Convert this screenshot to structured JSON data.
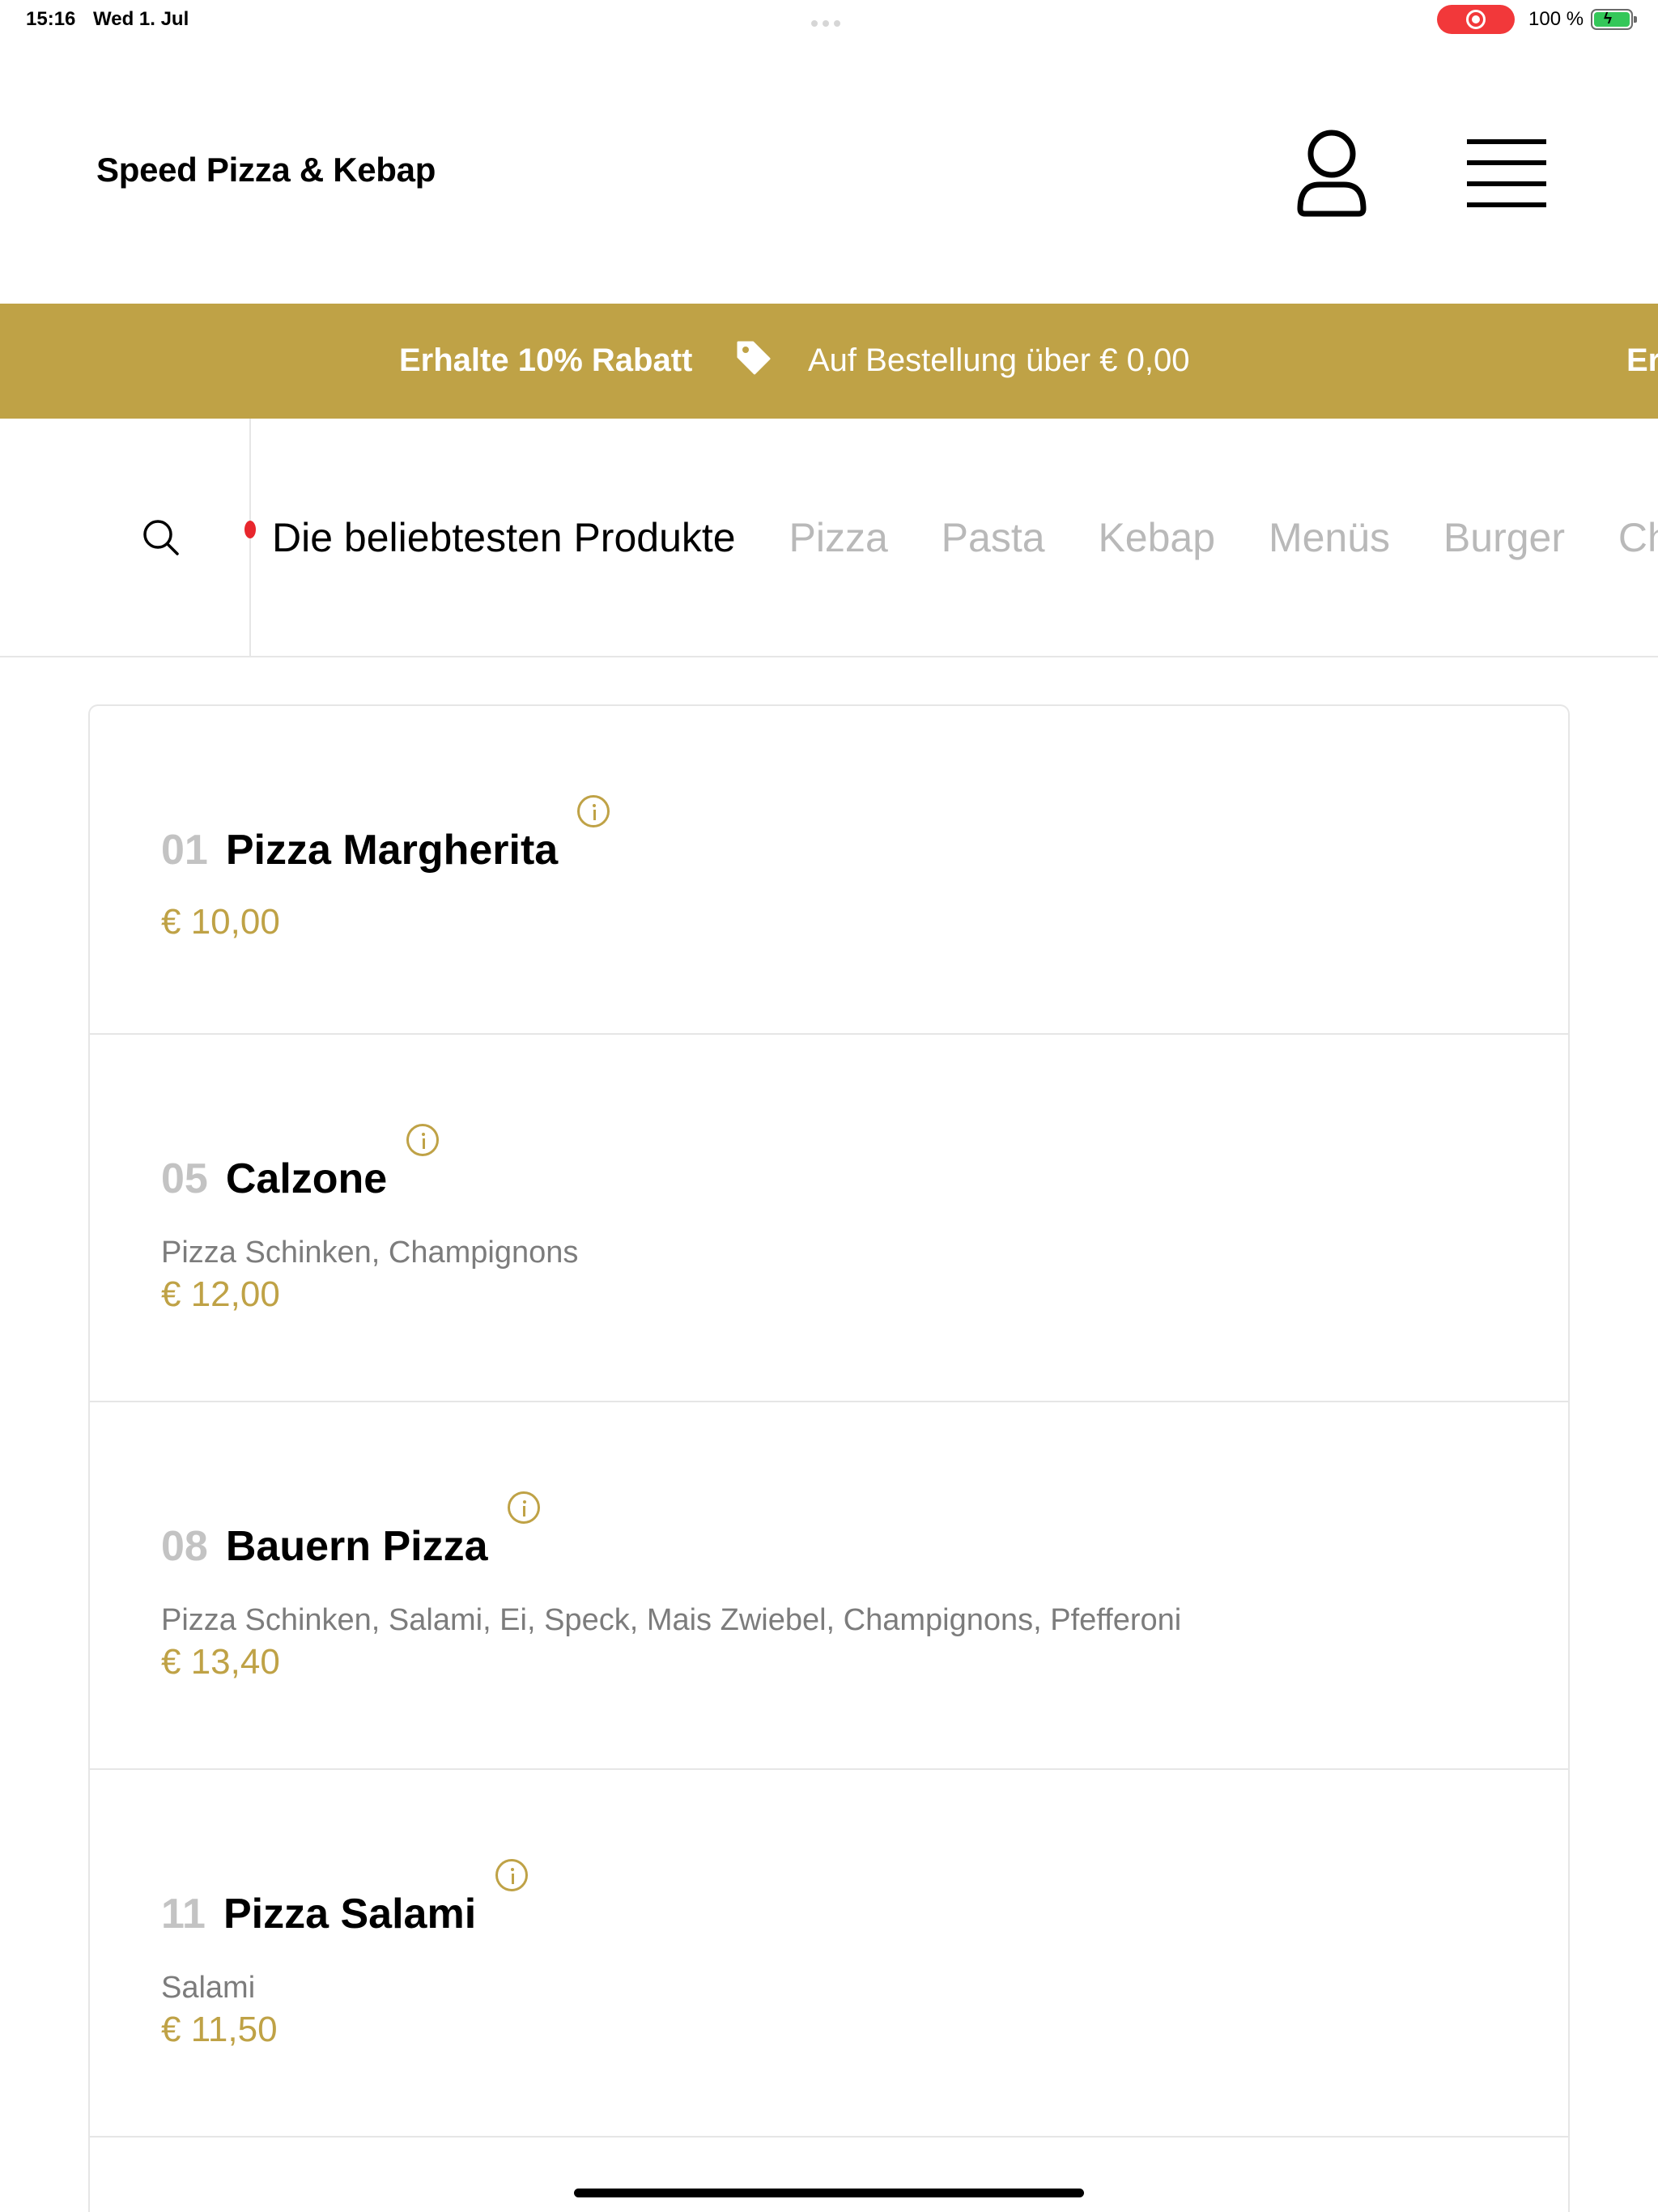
{
  "status_bar": {
    "time": "15:16",
    "date": "Wed 1. Jul",
    "battery_percent": "100 %"
  },
  "header": {
    "brand": "Speed Pizza & Kebap",
    "user_icon": "user-icon",
    "menu_icon": "hamburger-menu-icon"
  },
  "banner": {
    "headline": "Erhalte 10% Rabatt",
    "condition": "Auf Bestellung über € 0,00",
    "repeat_fragment": "Er",
    "background_color": "#bfa246"
  },
  "category_nav": {
    "search_icon": "search-icon",
    "categories": [
      {
        "label": "Die beliebtesten Produkte",
        "active": true
      },
      {
        "label": "Pizza",
        "active": false
      },
      {
        "label": "Pasta",
        "active": false
      },
      {
        "label": "Kebap",
        "active": false
      },
      {
        "label": "Menüs",
        "active": false
      },
      {
        "label": "Burger",
        "active": false
      },
      {
        "label": "Che",
        "active": false
      }
    ]
  },
  "products": [
    {
      "number": "01",
      "name": "Pizza Margherita",
      "description": "",
      "price": "€ 10,00"
    },
    {
      "number": "05",
      "name": "Calzone",
      "description": "Pizza Schinken, Champignons",
      "price": "€ 12,00"
    },
    {
      "number": "08",
      "name": "Bauern Pizza",
      "description": "Pizza Schinken, Salami, Ei, Speck, Mais Zwiebel, Champignons, Pfefferoni",
      "price": "€ 13,40"
    },
    {
      "number": "11",
      "name": "Pizza Salami",
      "description": "Salami",
      "price": "€ 11,50"
    }
  ],
  "colors": {
    "accent": "#bfa246",
    "muted_text": "#7c7c7c",
    "inactive_category": "#b9b9b9"
  }
}
